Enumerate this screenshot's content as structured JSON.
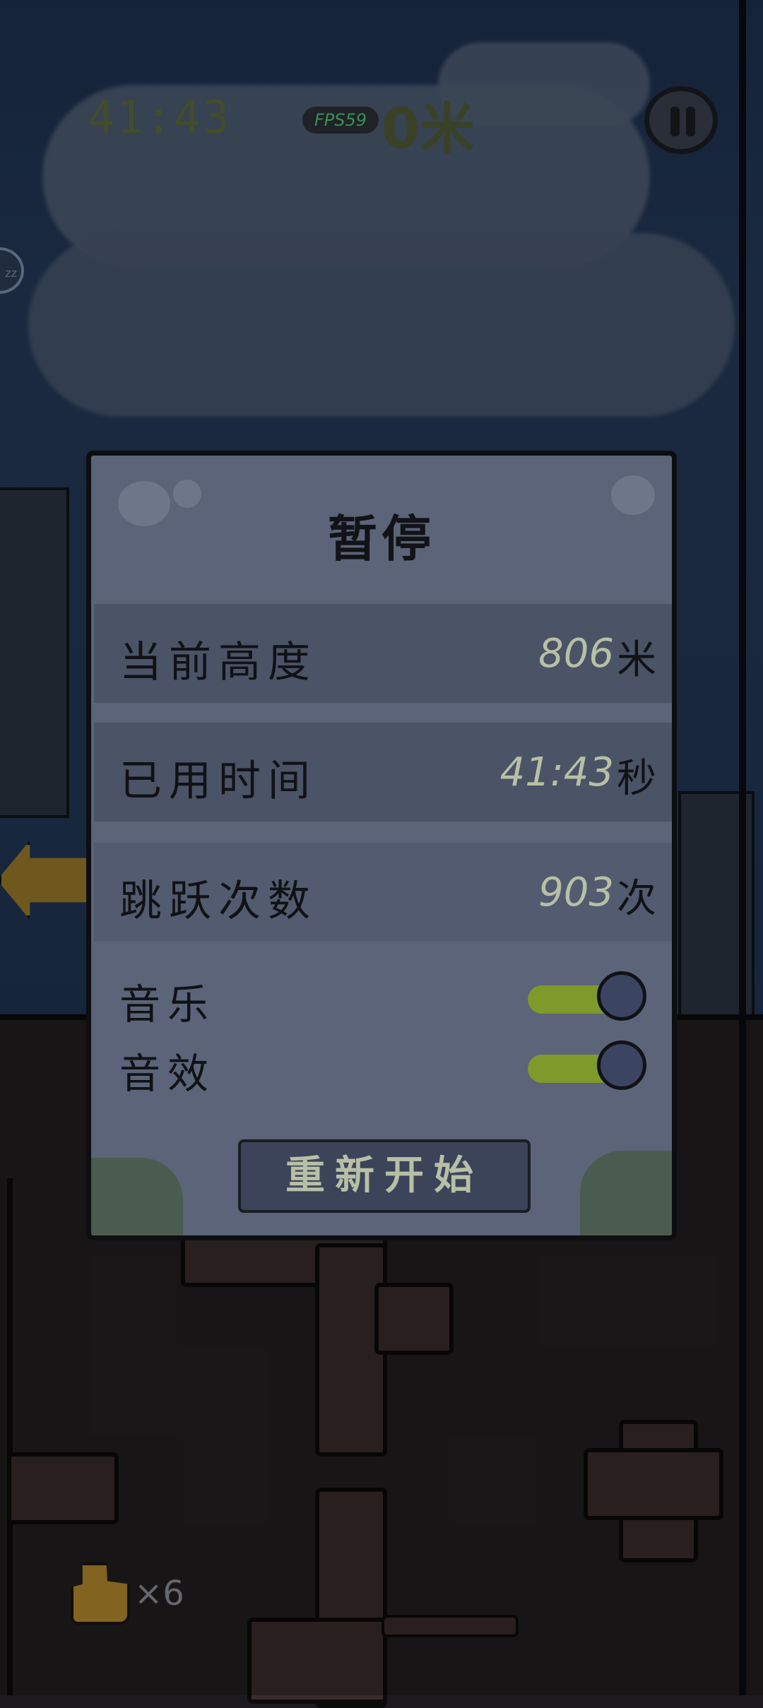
{
  "hud": {
    "time": "41:43",
    "fps": "FPS59",
    "height_value": "0",
    "height_unit": "米",
    "side_bubble": "zz",
    "lives_count": "×6"
  },
  "pause_dialog": {
    "title": "暂停",
    "stats": [
      {
        "label": "当前高度",
        "value": "806",
        "unit": "米"
      },
      {
        "label": "已用时间",
        "value": "41:43",
        "unit": "秒"
      },
      {
        "label": "跳跃次数",
        "value": "903",
        "unit": "次"
      }
    ],
    "toggles": [
      {
        "label": "音乐",
        "on": true
      },
      {
        "label": "音效",
        "on": true
      }
    ],
    "restart_label": "重新开始"
  },
  "colors": {
    "dialog_bg": "#5b6478",
    "row_bg": "#4b5366",
    "toggle_on": "#7d9a2a",
    "value_text": "#b7bfa6",
    "fps_text": "#53c275"
  }
}
